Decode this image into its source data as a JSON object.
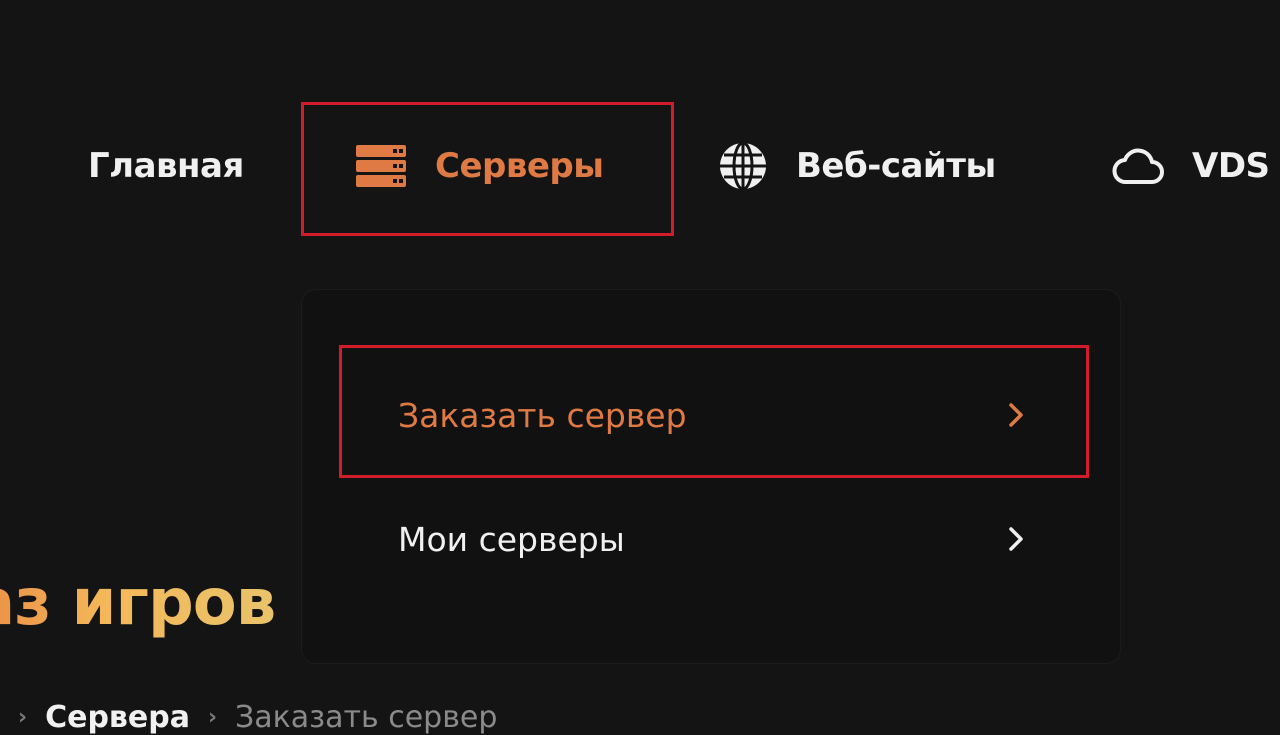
{
  "nav": {
    "items": [
      {
        "label": "Главная",
        "icon": "none",
        "active": false
      },
      {
        "label": "Серверы",
        "icon": "server-stack-icon",
        "active": true
      },
      {
        "label": "Веб-сайты",
        "icon": "globe-icon",
        "active": false
      },
      {
        "label": "VDS",
        "icon": "cloud-icon",
        "active": false
      }
    ]
  },
  "dropdown": {
    "items": [
      {
        "label": "Заказать сервер",
        "active": true
      },
      {
        "label": "Мои серверы",
        "active": false
      }
    ]
  },
  "page": {
    "heading": "аз игров",
    "breadcrumb": {
      "separator": "›",
      "link": "Сервера",
      "current": "Заказать сервер"
    }
  },
  "colors": {
    "background": "#141414",
    "accent": "#e07a45",
    "text": "#f0f0f0",
    "highlight": "#d01c2b"
  }
}
